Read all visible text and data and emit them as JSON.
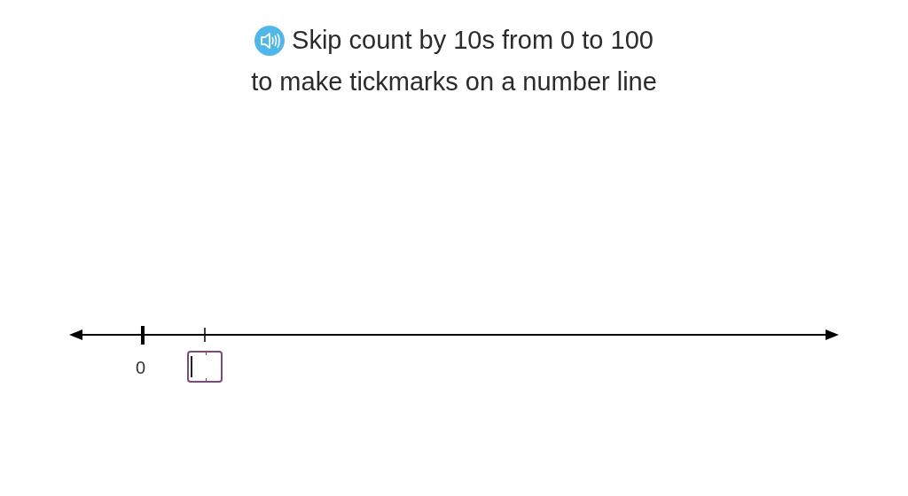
{
  "prompt": {
    "lines": [
      "Skip count by 10s from 0 to 100",
      "to make tickmarks on a number line"
    ]
  },
  "number_line": {
    "start_label": "0"
  },
  "answer_field": {
    "focused": true
  }
}
